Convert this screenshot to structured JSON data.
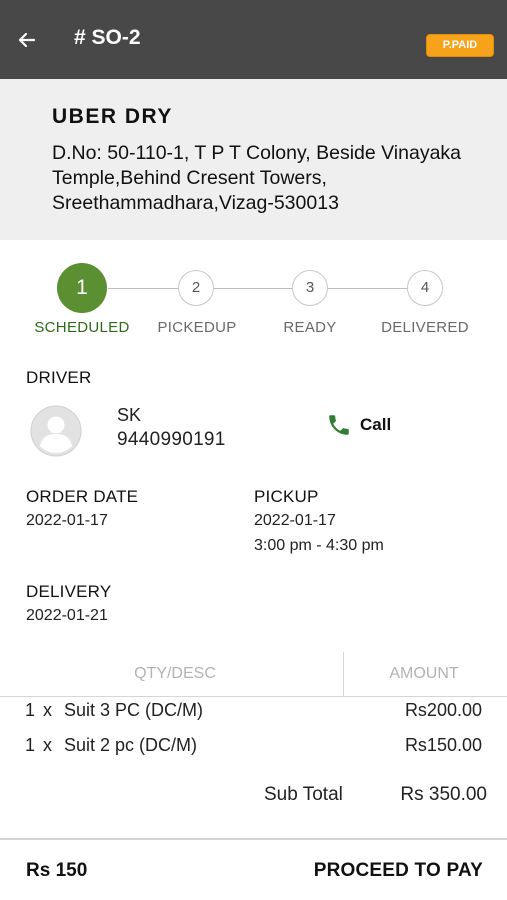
{
  "header": {
    "title": "# SO-2",
    "badge": "P.PAID",
    "badge_color": "#f6a31b",
    "back_icon": "arrow-left-icon"
  },
  "store": {
    "name": "UBER DRY",
    "address": "D.No: 50-110-1, T P T Colony, Beside Vinayaka Temple,Behind Cresent Towers, Sreethammadhara,Vizag-530013"
  },
  "steps": [
    {
      "number": "1",
      "label": "SCHEDULED",
      "active": true
    },
    {
      "number": "2",
      "label": "PICKEDUP",
      "active": false
    },
    {
      "number": "3",
      "label": "READY",
      "active": false
    },
    {
      "number": "4",
      "label": "DELIVERED",
      "active": false
    }
  ],
  "active_step_color": "#5a8f32",
  "driver": {
    "label": "DRIVER",
    "name": "SK",
    "phone": "9440990191",
    "call_label": "Call",
    "call_icon": "phone-icon",
    "call_icon_color": "#2e7d32"
  },
  "order_date": {
    "label": "ORDER DATE",
    "value": "2022-01-17"
  },
  "pickup": {
    "label": "PICKUP",
    "date": "2022-01-17",
    "time": "3:00 pm - 4:30 pm"
  },
  "delivery": {
    "label": "DELIVERY",
    "value": "2022-01-21"
  },
  "table": {
    "headers": {
      "qty_desc": "QTY/DESC",
      "amount": "AMOUNT"
    },
    "rows": [
      {
        "qty": "1",
        "x": "x",
        "desc": "Suit 3 PC (DC/M)",
        "amount": "Rs200.00"
      },
      {
        "qty": "1",
        "x": "x",
        "desc": "Suit 2 pc (DC/M)",
        "amount": "Rs150.00"
      }
    ],
    "subtotal_label": "Sub Total",
    "subtotal_value": "Rs 350.00"
  },
  "footer": {
    "amount": "Rs 150",
    "pay_label": "PROCEED TO PAY"
  }
}
